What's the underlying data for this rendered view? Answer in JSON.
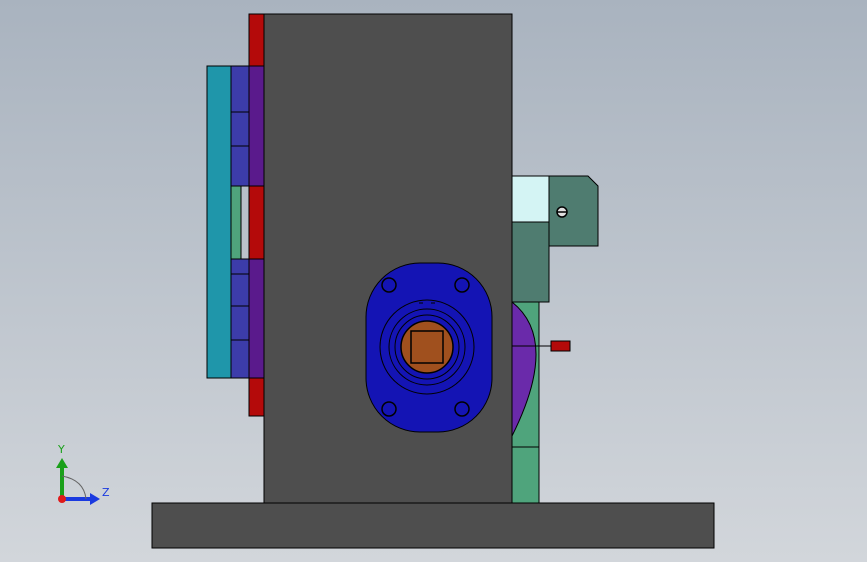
{
  "view": {
    "background_top": "#a9b3bf",
    "background_bottom": "#d2d6db"
  },
  "colors": {
    "body_gray": "#4e4e4e",
    "base_gray": "#4e4e4e",
    "red": "#b40a0a",
    "teal": "#1f96aa",
    "indigo": "#3c3caa",
    "purple": "#5a1a8c",
    "mint": "#4fa47c",
    "light_cyan": "#d4f4f4",
    "slate_green": "#4f7c70",
    "violet": "#6a2aaa",
    "flange_blue": "#1414b4",
    "bronze": "#a0501e",
    "edge": "#000000"
  },
  "triad": {
    "y_label": "Y",
    "z_label": "Z",
    "y_color": "#1aa01a",
    "z_color": "#1a3ae0",
    "origin_color": "#e01a1a"
  }
}
